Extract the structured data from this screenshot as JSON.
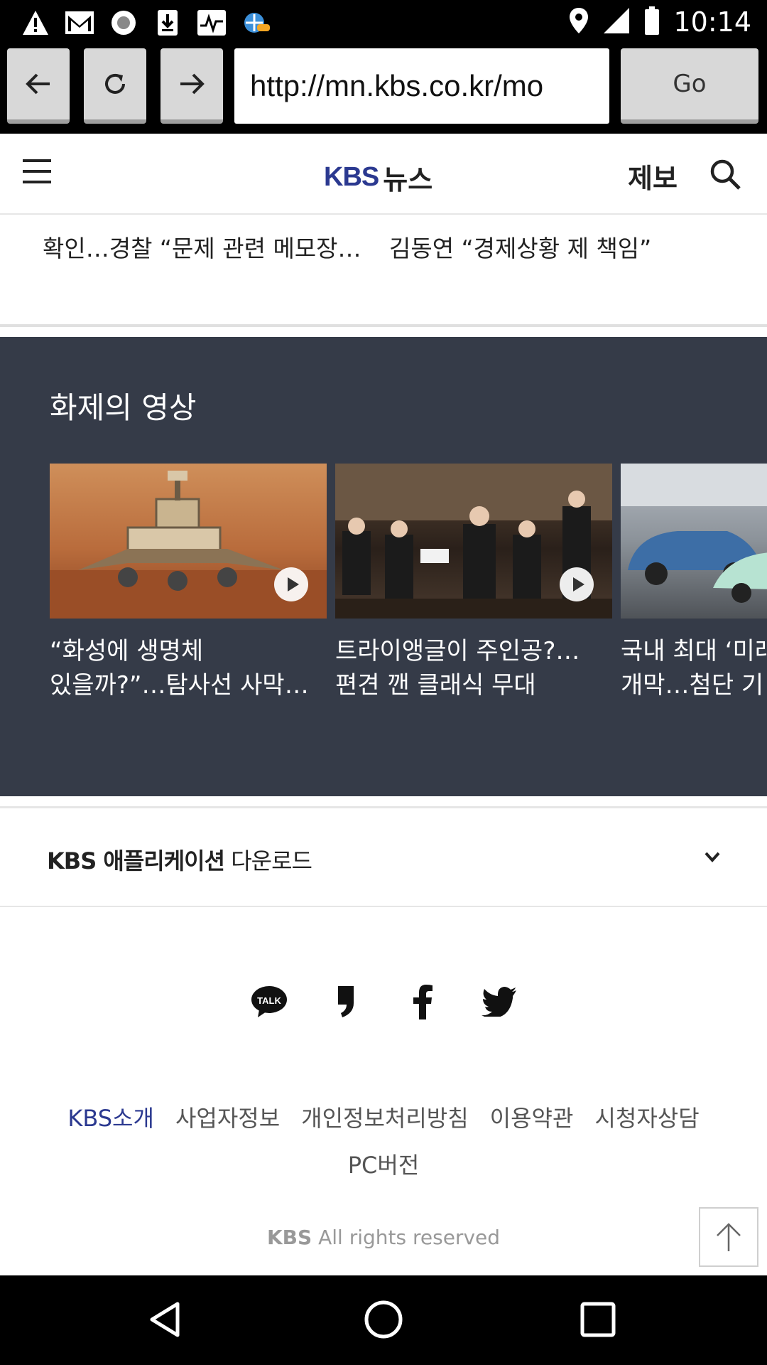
{
  "status_bar": {
    "time": "10:14",
    "icons": [
      "warning-icon",
      "gmail-icon",
      "record-icon",
      "download-icon",
      "pulse-icon",
      "weather-icon",
      "location-icon",
      "signal-icon",
      "battery-icon"
    ]
  },
  "browser": {
    "url": "http://mn.kbs.co.kr/mo",
    "go_label": "Go"
  },
  "header": {
    "logo_brand": "KBS",
    "logo_suffix": "뉴스",
    "report_label": "제보"
  },
  "news_partial": [
    {
      "line": "확인…경찰 “문제 관련 메모장…"
    },
    {
      "line": "김동연 “경제상황 제 책임”"
    }
  ],
  "video_section": {
    "title": "화제의 영상",
    "videos": [
      {
        "line1": "“화성에 생명체",
        "line2": "있을까?”…탐사선 사막…"
      },
      {
        "line1": "트라이앵글이 주인공?…",
        "line2": "편견 깬 클래식 무대"
      },
      {
        "line1": "국내 최대 ‘미래",
        "line2": "개막…첨단 기"
      }
    ]
  },
  "app_download": {
    "bold": "KBS 애플리케이션",
    "rest": " 다운로드"
  },
  "footer": {
    "links": [
      "KBS소개",
      "사업자정보",
      "개인정보처리방침",
      "이용약관",
      "시청자상담"
    ],
    "pc_link": "PC버전",
    "copyright_brand": "KBS",
    "copyright_text": " All rights reserved"
  }
}
